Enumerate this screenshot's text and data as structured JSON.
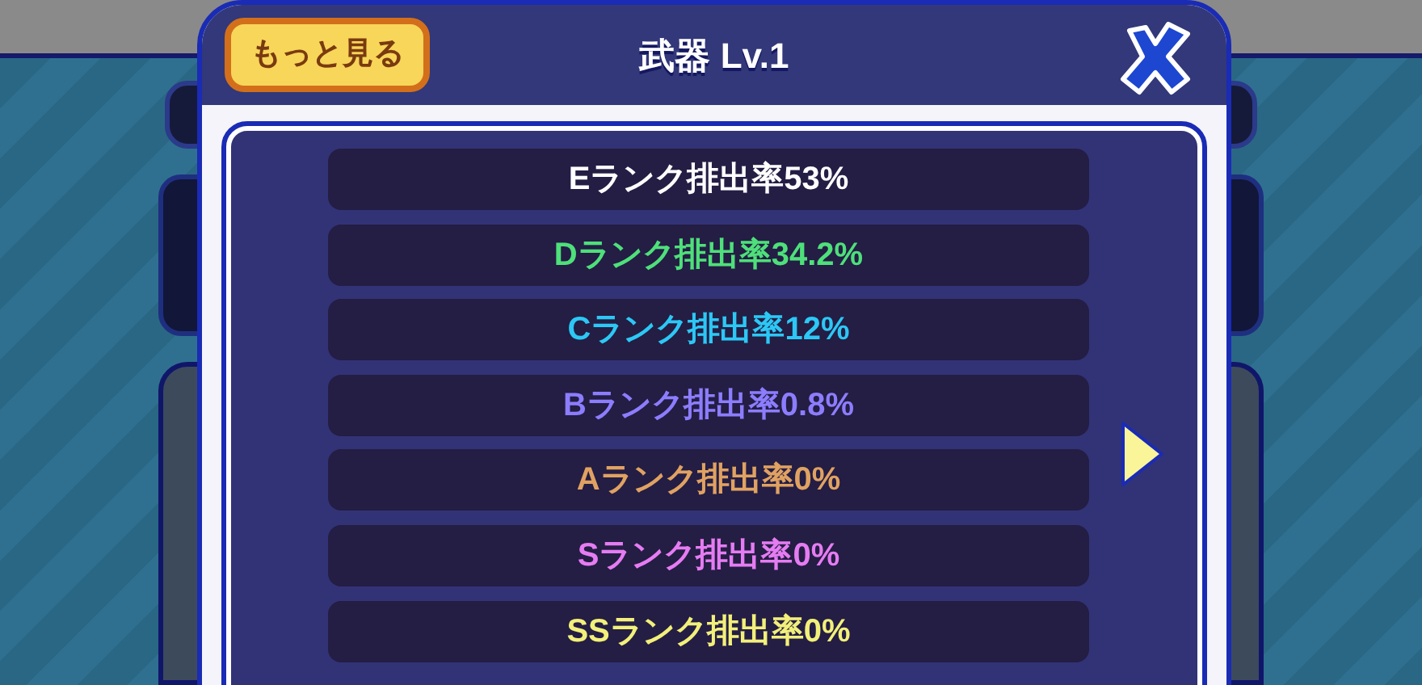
{
  "header": {
    "more_button": "もっと見る",
    "title": "武器 Lv.1"
  },
  "rates": [
    {
      "label": "Eランク排出率53%",
      "color": "#ffffff"
    },
    {
      "label": "Dランク排出率34.2%",
      "color": "#4ee07a"
    },
    {
      "label": "Cランク排出率12%",
      "color": "#2cc8f5"
    },
    {
      "label": "Bランク排出率0.8%",
      "color": "#8c7dff"
    },
    {
      "label": "Aランク排出率0%",
      "color": "#e0a262"
    },
    {
      "label": "Sランク排出率0%",
      "color": "#e57cf2"
    },
    {
      "label": "SSランク排出率0%",
      "color": "#f2f07a"
    }
  ]
}
